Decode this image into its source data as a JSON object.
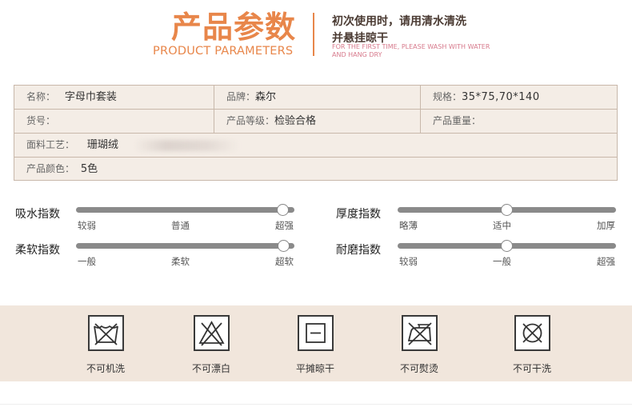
{
  "header": {
    "title_cn": "产品参数",
    "title_en": "PRODUCT PARAMETERS",
    "note_line1": "初次使用时，请用清水清洗",
    "note_line2": "并悬挂晾干",
    "note_en": "FOR THE FIRST TIME, PLEASE WASH WITH WATER AND HANG DRY"
  },
  "params": {
    "name_label": "名称：",
    "name_value": "字母巾套装",
    "brand_label": "品牌：",
    "brand_value": "森尔",
    "spec_label": "规格：",
    "spec_value": "35*75,70*140",
    "item_no_label": "货号：",
    "grade_label": "产品等级：",
    "grade_value": "检验合格",
    "weight_label": "产品重量：",
    "fabric_label": "面料工艺：",
    "fabric_value": "珊瑚绒",
    "color_label": "产品颜色：",
    "color_value": "5色"
  },
  "sliders": [
    {
      "name": "吸水指数",
      "ticks": [
        "较弱",
        "普通",
        "超强"
      ],
      "level": 0.95
    },
    {
      "name": "厚度指数",
      "ticks": [
        "略薄",
        "适中",
        "加厚"
      ],
      "level": 0.5
    },
    {
      "name": "柔软指数",
      "ticks": [
        "一般",
        "柔软",
        "超软"
      ],
      "level": 0.95
    },
    {
      "name": "耐磨指数",
      "ticks": [
        "较弱",
        "一般",
        "超强"
      ],
      "level": 0.5
    }
  ],
  "care": [
    {
      "icon": "no-machine-wash-icon",
      "label": "不可机洗"
    },
    {
      "icon": "no-bleach-icon",
      "label": "不可漂白"
    },
    {
      "icon": "flat-dry-icon",
      "label": "平摊晾干"
    },
    {
      "icon": "no-iron-icon",
      "label": "不可熨烫"
    },
    {
      "icon": "no-dry-clean-icon",
      "label": "不可干洗"
    }
  ]
}
